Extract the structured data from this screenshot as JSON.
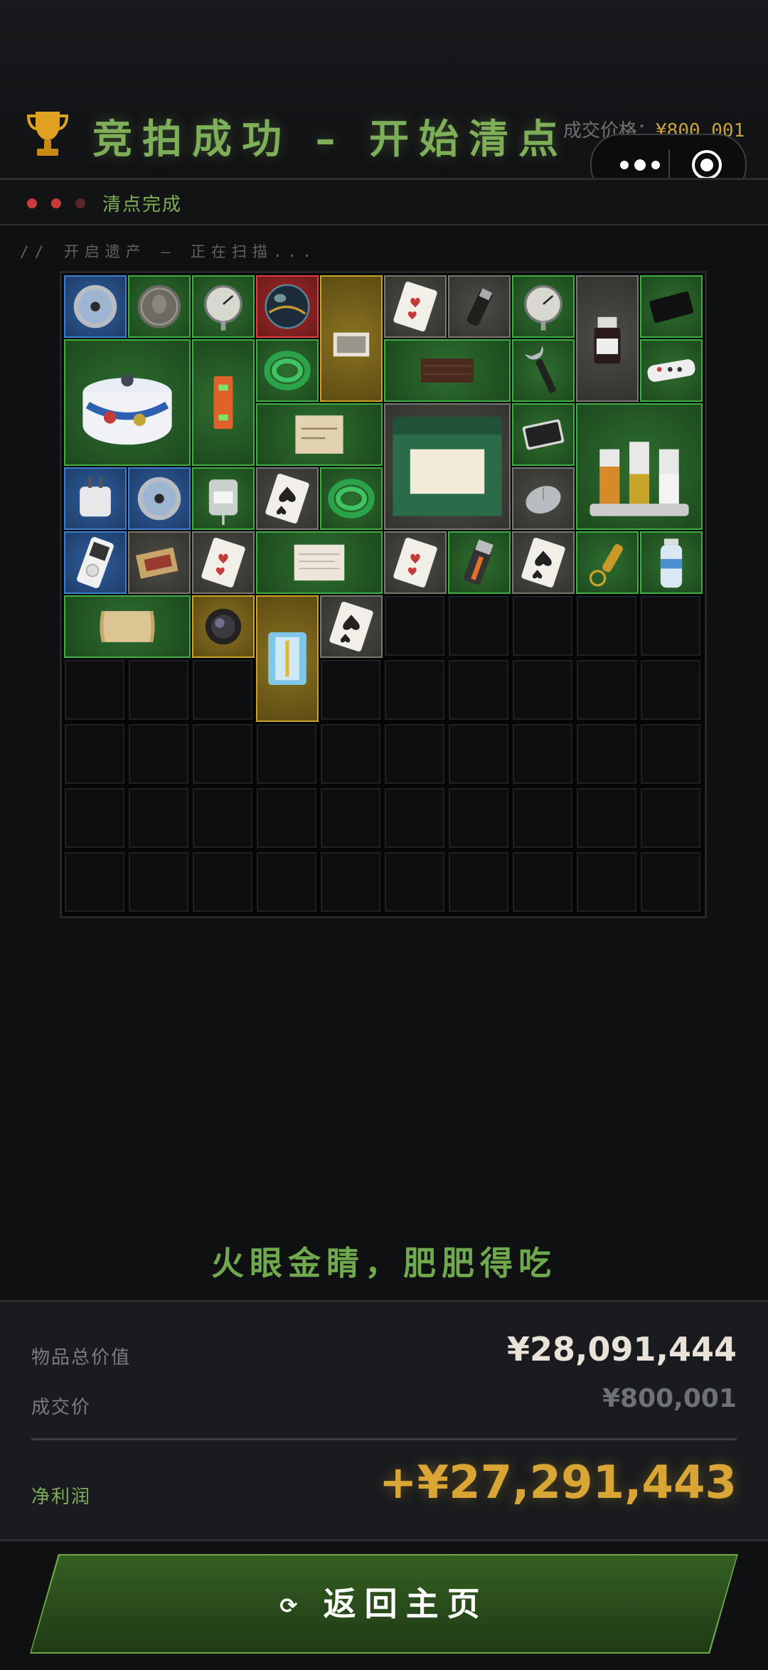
{
  "header": {
    "title": "竞拍成功 – 开始清点",
    "deal_label": "成交价格：",
    "deal_value": "¥800,001"
  },
  "status": {
    "text": "清点完成",
    "lights": [
      "#c93a3a",
      "#c93a3a",
      "#5a2626"
    ]
  },
  "scan_text": "// 开启遗产 – 正在扫描...",
  "items": [
    {
      "name": "item-cd-disc",
      "icon": "disc-icon",
      "rarity": "blue"
    },
    {
      "name": "item-coin",
      "icon": "coin-icon",
      "rarity": "green"
    },
    {
      "name": "item-gauge",
      "icon": "gauge-icon",
      "rarity": "green"
    },
    {
      "name": "item-glass-orb",
      "icon": "orb-icon",
      "rarity": "red"
    },
    {
      "name": "item-photo",
      "icon": "photo-icon",
      "rarity": "gold"
    },
    {
      "name": "item-card-hearts",
      "icon": "card-hearts-icon",
      "rarity": "gray"
    },
    {
      "name": "item-grinder",
      "icon": "grinder-icon",
      "rarity": "gray"
    },
    {
      "name": "item-gauge-2",
      "icon": "gauge-icon",
      "rarity": "green"
    },
    {
      "name": "item-sample-bottle",
      "icon": "bottle-icon",
      "rarity": "gray"
    },
    {
      "name": "item-good-luck-card",
      "icon": "black-card-icon",
      "rarity": "green"
    },
    {
      "name": "item-enamel-pot",
      "icon": "pot-icon",
      "rarity": "green"
    },
    {
      "name": "item-level-tool",
      "icon": "level-icon",
      "rarity": "green"
    },
    {
      "name": "item-green-hose",
      "icon": "hose-icon",
      "rarity": "green"
    },
    {
      "name": "item-wood-plank",
      "icon": "plank-icon",
      "rarity": "green"
    },
    {
      "name": "item-wrench",
      "icon": "wrench-icon",
      "rarity": "green"
    },
    {
      "name": "item-power-strip",
      "icon": "power-strip-icon",
      "rarity": "green"
    },
    {
      "name": "item-old-map",
      "icon": "map-icon",
      "rarity": "green"
    },
    {
      "name": "item-candle-box",
      "icon": "candle-box-icon",
      "rarity": "gray"
    },
    {
      "name": "item-hard-drive",
      "icon": "drive-icon",
      "rarity": "green"
    },
    {
      "name": "item-spice-rack",
      "icon": "spice-rack-icon",
      "rarity": "green"
    },
    {
      "name": "item-adapter",
      "icon": "adapter-icon",
      "rarity": "blue"
    },
    {
      "name": "item-cd-disc-2",
      "icon": "disc-icon",
      "rarity": "blue"
    },
    {
      "name": "item-iv-bag",
      "icon": "iv-bag-icon",
      "rarity": "green"
    },
    {
      "name": "item-card-spades",
      "icon": "card-spades-icon",
      "rarity": "gray"
    },
    {
      "name": "item-green-hose-2",
      "icon": "hose-icon",
      "rarity": "green"
    },
    {
      "name": "item-mouse",
      "icon": "mouse-icon",
      "rarity": "gray"
    },
    {
      "name": "item-music-player",
      "icon": "player-icon",
      "rarity": "blue"
    },
    {
      "name": "item-matchbox",
      "icon": "matchbox-icon",
      "rarity": "gray"
    },
    {
      "name": "item-card-hearts-2",
      "icon": "card-hearts-icon",
      "rarity": "gray"
    },
    {
      "name": "item-parchment",
      "icon": "parchment-icon",
      "rarity": "green"
    },
    {
      "name": "item-card-hearts-3",
      "icon": "card-hearts-icon",
      "rarity": "gray"
    },
    {
      "name": "item-lighter",
      "icon": "lighter-icon",
      "rarity": "green"
    },
    {
      "name": "item-card-spades-2",
      "icon": "card-spades-icon",
      "rarity": "gray"
    },
    {
      "name": "item-bullet-keychain",
      "icon": "bullet-icon",
      "rarity": "green"
    },
    {
      "name": "item-water-bottle",
      "icon": "water-bottle-icon",
      "rarity": "green"
    },
    {
      "name": "item-scroll",
      "icon": "scroll-icon",
      "rarity": "green"
    },
    {
      "name": "item-lens",
      "icon": "lens-icon",
      "rarity": "gold"
    },
    {
      "name": "item-syringe-kit",
      "icon": "syringe-icon",
      "rarity": "gold"
    },
    {
      "name": "item-card-spades-3",
      "icon": "card-spades-icon",
      "rarity": "gray"
    }
  ],
  "slogan": "火眼金睛，肥肥得吃",
  "summary": {
    "total_label": "物品总价值",
    "total_value": "¥28,091,444",
    "deal_label": "成交价",
    "deal_value": "¥800,001",
    "profit_label": "净利润",
    "profit_value": "+¥27,291,443"
  },
  "home_button": {
    "icon": "refresh-icon",
    "label": "返回主页"
  },
  "colors": {
    "accent_green": "#7fae59",
    "gold": "#d9a635",
    "rarity_green": "#3fae42",
    "rarity_blue": "#3d7ed0",
    "rarity_gold": "#c9a227",
    "rarity_gray": "#78786f",
    "rarity_red": "#e04040"
  }
}
